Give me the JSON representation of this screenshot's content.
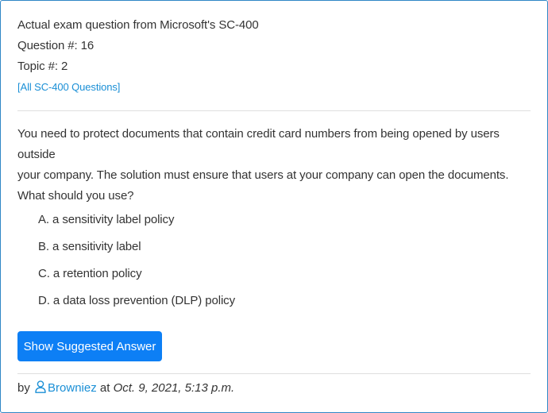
{
  "header": {
    "line1": "Actual exam question from Microsoft's SC-400",
    "line2": "Question #: 16",
    "line3": "Topic #: 2",
    "all_questions_link": "[All SC-400 Questions]"
  },
  "question": {
    "text_line1": "You need to protect documents that contain credit card numbers from being opened by users outside",
    "text_line2": "your company. The solution must ensure that users at your company can open the documents.",
    "text_line3": "What should you use?"
  },
  "choices": [
    "A. a sensitivity label policy",
    "B. a sensitivity label",
    "C. a retention policy",
    "D. a data loss prevention (DLP) policy"
  ],
  "show_answer_button": "Show Suggested Answer",
  "footer": {
    "by": "by",
    "username": "Browniez",
    "at": "at",
    "date": "Oct. 9, 2021, 5:13 p.m."
  },
  "colors": {
    "accent": "#0d7ff5",
    "link": "#1a8fd6",
    "border": "#2f86c6"
  },
  "icons": {
    "user": "user-icon"
  }
}
